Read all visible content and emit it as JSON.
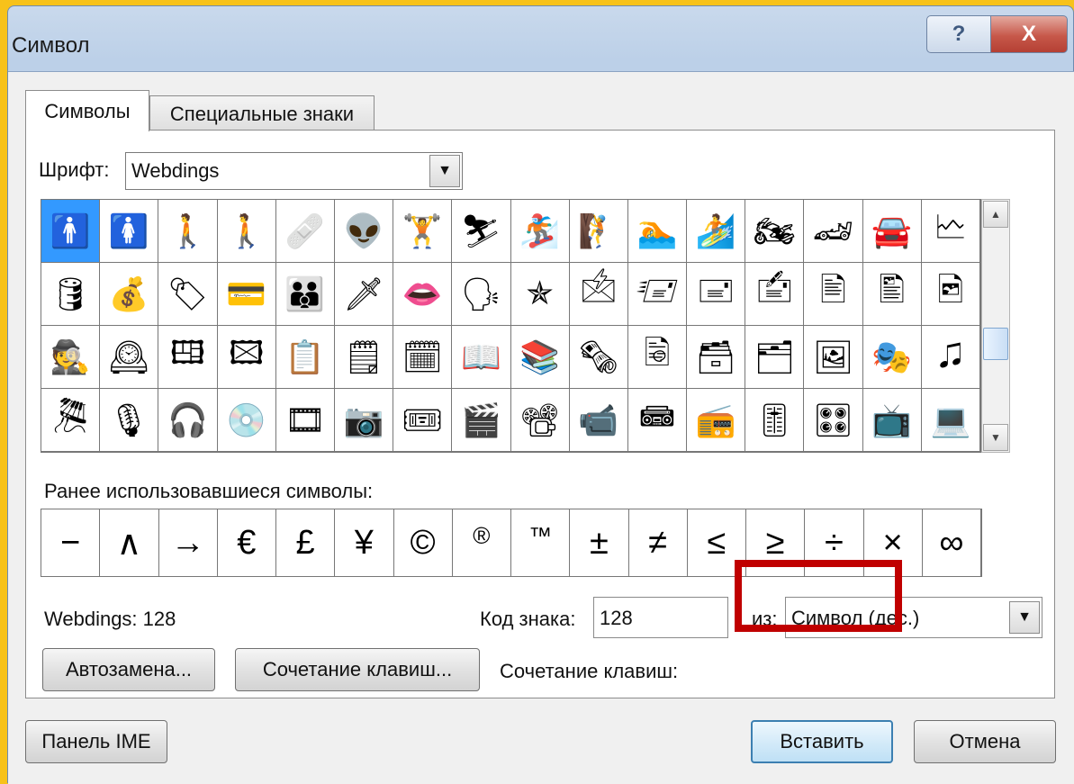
{
  "window": {
    "title": "Символ",
    "help_glyph": "?",
    "close_glyph": "X"
  },
  "tabs": [
    {
      "label": "Символы",
      "active": true
    },
    {
      "label": "Специальные знаки",
      "active": false
    }
  ],
  "font": {
    "label": "Шрифт:",
    "value": "Webdings",
    "dropdown_glyph": "▼"
  },
  "symbols": {
    "selected_index": 0,
    "rows": [
      [
        "🚹",
        "🚺",
        "🚶",
        "🚶",
        "🩹",
        "👽",
        "🏋",
        "⛷",
        "🏂",
        "🧗",
        "🏊",
        "🏄",
        "🏍",
        "🏎",
        "🚘",
        "🗠"
      ],
      [
        "🛢",
        "💰",
        "🏷",
        "💳",
        "👪",
        "🗡",
        "👄",
        "🗣",
        "✯",
        "🖄",
        "🖅",
        "🖃",
        "🖆",
        "🖹",
        "🖺",
        "🖻"
      ],
      [
        "🕵",
        "🕰",
        "🖽",
        "🖾",
        "📋",
        "🗒",
        "🗓",
        "📖",
        "📚",
        "🗞",
        "🗟",
        "🗃",
        "🗂",
        "🖼",
        "🎭",
        "🎜"
      ],
      [
        "🎘",
        "🎙",
        "🎧",
        "💿",
        "🎞",
        "📷",
        "🎟",
        "🎬",
        "📽",
        "📹",
        "📾",
        "📻",
        "🎚",
        "🎛",
        "📺",
        "💻"
      ]
    ],
    "scroll_up": "▲",
    "scroll_down": "▼"
  },
  "recent": {
    "label": "Ранее использовавшиеся символы:",
    "items": [
      "−",
      "∧",
      "→",
      "€",
      "£",
      "¥",
      "©",
      "®",
      "™",
      "±",
      "≠",
      "≤",
      "≥",
      "÷",
      "×",
      "∞"
    ]
  },
  "status": {
    "font_code_text": "Webdings: 128",
    "code_label": "Код знака:",
    "code_value": "128",
    "from_label": "из:",
    "from_value": "Символ (дес.)",
    "shortcut_label": "Сочетание клавиш:"
  },
  "buttons": {
    "autocorrect": "Автозамена...",
    "shortcut_key": "Сочетание клавиш...",
    "ime_pad": "Панель IME",
    "insert": "Вставить",
    "cancel": "Отмена"
  },
  "annotation": {
    "highlight_color": "#c00000"
  }
}
